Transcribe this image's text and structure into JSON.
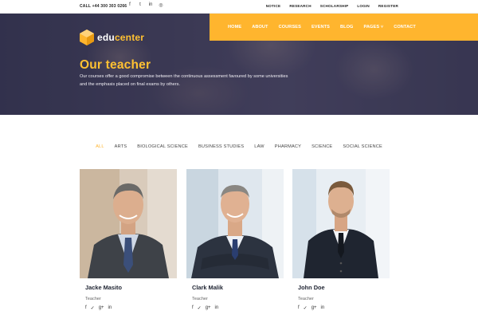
{
  "topbar": {
    "call": "CALL +44 300 303 0266",
    "social_icons": [
      "facebook-icon",
      "twitter-icon",
      "linkedin-icon",
      "instagram-icon"
    ],
    "social_glyphs": [
      "f",
      "t",
      "in",
      "◎"
    ],
    "links": [
      "NOTICE",
      "RESEARCH",
      "SCHOLARSHIP",
      "LOGIN",
      "REGISTER"
    ]
  },
  "logo": {
    "part1": "edu",
    "part2": "center"
  },
  "nav": {
    "items": [
      "HOME",
      "ABOUT",
      "COURSES",
      "EVENTS",
      "BLOG",
      "PAGES ˅",
      "CONTACT"
    ]
  },
  "hero": {
    "title": "Our teacher",
    "text": "Our courses offer a good compromise between the continuous assessment favoured by some universities and the emphasis placed on final exams by others."
  },
  "filters": {
    "items": [
      "ALL",
      "ARTS",
      "BIOLOGICAL SCIENCE",
      "BUSINESS STUDIES",
      "LAW",
      "PHARMACY",
      "SCIENCE",
      "SOCIAL SCIENCE"
    ],
    "active": "ALL"
  },
  "teachers": [
    {
      "name": "Jacke Masito",
      "role": "Teacher"
    },
    {
      "name": "Clark Malik",
      "role": "Teacher"
    },
    {
      "name": "John Doe",
      "role": "Teacher"
    }
  ],
  "card_social_glyphs": [
    "f",
    "✓",
    "g+",
    "in"
  ],
  "colors": {
    "accent": "#ffb52e",
    "title": "#ffc132",
    "dark": "#1f2432"
  }
}
